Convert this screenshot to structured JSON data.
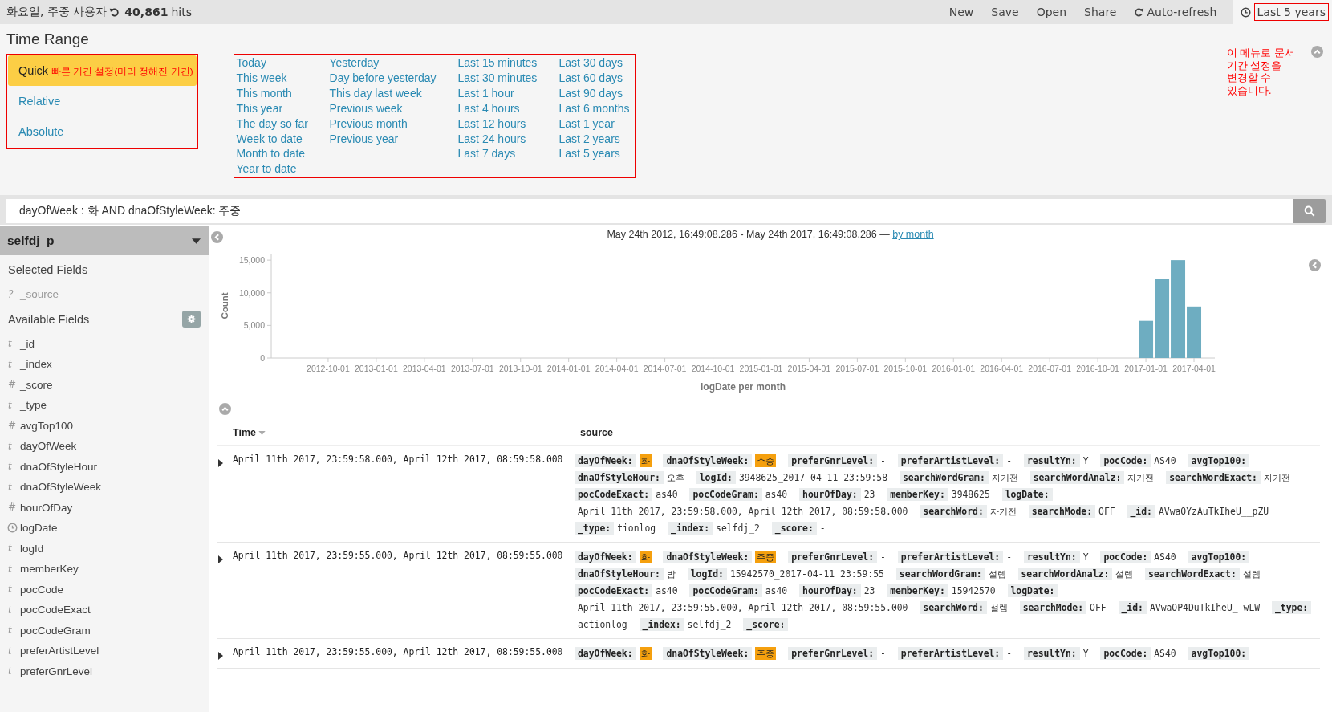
{
  "top_bar": {
    "title": "화요일, 주중 사용자",
    "hits_count": "40,861",
    "hits_label": "hits",
    "menu": [
      {
        "label": "New",
        "kind": "action"
      },
      {
        "label": "Save",
        "kind": "action"
      },
      {
        "label": "Open",
        "kind": "action"
      },
      {
        "label": "Share",
        "kind": "action"
      },
      {
        "label": "Auto-refresh",
        "kind": "refresh"
      }
    ],
    "time_picker": {
      "label": "Last 5 years"
    }
  },
  "time_range": {
    "title": "Time Range",
    "modes": [
      {
        "label": "Quick",
        "selected": true,
        "annotation": "빠른 기간 설정(미리 정해진 기간)"
      },
      {
        "label": "Relative",
        "selected": false
      },
      {
        "label": "Absolute",
        "selected": false
      }
    ],
    "quick_ranges": [
      [
        "Today",
        "This week",
        "This month",
        "This year",
        "The day so far",
        "Week to date",
        "Month to date",
        "Year to date"
      ],
      [
        "Yesterday",
        "Day before yesterday",
        "This day last week",
        "Previous week",
        "Previous month",
        "Previous year"
      ],
      [
        "Last 15 minutes",
        "Last 30 minutes",
        "Last 1 hour",
        "Last 4 hours",
        "Last 12 hours",
        "Last 24 hours",
        "Last 7 days"
      ],
      [
        "Last 30 days",
        "Last 60 days",
        "Last 90 days",
        "Last 6 months",
        "Last 1 year",
        "Last 2 years",
        "Last 5 years"
      ]
    ],
    "annotation": "이 메뉴로 문서 기간 설정을 변경할 수 있습니다."
  },
  "query": {
    "value": "dayOfWeek : 화 AND dnaOfStyleWeek: 주중"
  },
  "sidebar": {
    "index_pattern": "selfdj_p",
    "selected_fields_title": "Selected Fields",
    "selected_fields": [
      {
        "name": "_source",
        "kind": "unknown",
        "glyph": "?"
      }
    ],
    "available_fields_title": "Available Fields",
    "available_fields": [
      {
        "name": "_id",
        "kind": "string",
        "glyph": "t"
      },
      {
        "name": "_index",
        "kind": "string",
        "glyph": "t"
      },
      {
        "name": "_score",
        "kind": "number",
        "glyph": "#"
      },
      {
        "name": "_type",
        "kind": "string",
        "glyph": "t"
      },
      {
        "name": "avgTop100",
        "kind": "number",
        "glyph": "#"
      },
      {
        "name": "dayOfWeek",
        "kind": "string",
        "glyph": "t"
      },
      {
        "name": "dnaOfStyleHour",
        "kind": "string",
        "glyph": "t"
      },
      {
        "name": "dnaOfStyleWeek",
        "kind": "string",
        "glyph": "t"
      },
      {
        "name": "hourOfDay",
        "kind": "number",
        "glyph": "#"
      },
      {
        "name": "logDate",
        "kind": "date"
      },
      {
        "name": "logId",
        "kind": "string",
        "glyph": "t"
      },
      {
        "name": "memberKey",
        "kind": "string",
        "glyph": "t"
      },
      {
        "name": "pocCode",
        "kind": "string",
        "glyph": "t"
      },
      {
        "name": "pocCodeExact",
        "kind": "string",
        "glyph": "t"
      },
      {
        "name": "pocCodeGram",
        "kind": "string",
        "glyph": "t"
      },
      {
        "name": "preferArtistLevel",
        "kind": "string",
        "glyph": "t"
      },
      {
        "name": "preferGnrLevel",
        "kind": "string",
        "glyph": "t"
      }
    ]
  },
  "histogram": {
    "range_text": "May 24th 2012, 16:49:08.286 - May 24th 2017, 16:49:08.286 — ",
    "interval_link": "by month",
    "chart_data": {
      "type": "bar",
      "xlabel": "logDate per month",
      "ylabel": "Count",
      "ylim": [
        0,
        16000
      ],
      "yticks": [
        {
          "value": 0,
          "label": "0"
        },
        {
          "value": 5000,
          "label": "5,000"
        },
        {
          "value": 10000,
          "label": "10,000"
        },
        {
          "value": 15000,
          "label": "15,000"
        }
      ],
      "categories": [
        null,
        null,
        null,
        "2012-10-01",
        null,
        null,
        "2013-01-01",
        null,
        null,
        "2013-04-01",
        null,
        null,
        "2013-07-01",
        null,
        null,
        "2013-10-01",
        null,
        null,
        "2014-01-01",
        null,
        null,
        "2014-04-01",
        null,
        null,
        "2014-07-01",
        null,
        null,
        "2014-10-01",
        null,
        null,
        "2015-01-01",
        null,
        null,
        "2015-04-01",
        null,
        null,
        "2015-07-01",
        null,
        null,
        "2015-10-01",
        null,
        null,
        "2016-01-01",
        null,
        null,
        "2016-04-01",
        null,
        null,
        "2016-07-01",
        null,
        null,
        "2016-10-01",
        null,
        null,
        "2017-01-01",
        null,
        null,
        "2017-04-01"
      ],
      "series": [
        {
          "color": "#6eadc1",
          "values": [
            null,
            null,
            null,
            null,
            null,
            null,
            null,
            null,
            null,
            null,
            null,
            null,
            null,
            null,
            null,
            null,
            null,
            null,
            null,
            null,
            null,
            null,
            null,
            null,
            null,
            null,
            null,
            null,
            null,
            null,
            null,
            null,
            null,
            null,
            null,
            null,
            null,
            null,
            null,
            null,
            null,
            null,
            null,
            null,
            null,
            null,
            null,
            null,
            null,
            null,
            null,
            null,
            null,
            null,
            5700,
            12100,
            15000,
            7900
          ]
        }
      ]
    }
  },
  "documents": {
    "columns": [
      "Time",
      "_source"
    ],
    "rows": [
      {
        "time": "April 11th 2017, 23:59:58.000, April 12th 2017, 08:59:58.000",
        "source": [
          {
            "key": "dayOfWeek:",
            "value": "화",
            "highlighted": true
          },
          {
            "key": "dnaOfStyleWeek:",
            "value": "주중",
            "highlighted": true
          },
          {
            "key": "preferGnrLevel:",
            "value": "-",
            "highlighted": false
          },
          {
            "key": "preferArtistLevel:",
            "value": "-",
            "highlighted": false
          },
          {
            "key": "resultYn:",
            "value": "Y",
            "highlighted": false
          },
          {
            "key": "pocCode:",
            "value": "AS40",
            "highlighted": false
          },
          {
            "key": "avgTop100:"
          },
          {
            "key": "dnaOfStyleHour:",
            "value": "오후",
            "highlighted": false
          },
          {
            "key": "logId:",
            "value": "3948625_2017-04-11 23:59:58",
            "highlighted": false
          },
          {
            "key": "searchWordGram:",
            "value": "자기전",
            "highlighted": false
          },
          {
            "key": "searchWordAnalz:",
            "value": "자기전",
            "highlighted": false
          },
          {
            "key": "searchWordExact:",
            "value": "자기전",
            "highlighted": false
          },
          {
            "key": "pocCodeExact:",
            "value": "as40",
            "highlighted": false
          },
          {
            "key": "pocCodeGram:",
            "value": "as40",
            "highlighted": false
          },
          {
            "key": "hourOfDay:",
            "value": "23",
            "highlighted": false
          },
          {
            "key": "memberKey:",
            "value": "3948625",
            "highlighted": false
          },
          {
            "key": "logDate:",
            "value": "April 11th 2017, 23:59:58.000, April 12th 2017, 08:59:58.000",
            "highlighted": false
          },
          {
            "key": "searchWord:",
            "value": "자기전",
            "highlighted": false
          },
          {
            "key": "searchMode:",
            "value": "OFF",
            "highlighted": false
          },
          {
            "key": "_id:",
            "value": "AVwaOYzAuTkIheU__pZU",
            "highlighted": false
          },
          {
            "key": "_type:",
            "value": "tionlog",
            "highlighted": false
          },
          {
            "key": "_index:",
            "value": "selfdj_2",
            "highlighted": false
          },
          {
            "key": "_score:",
            "value": "-",
            "highlighted": false
          }
        ]
      },
      {
        "time": "April 11th 2017, 23:59:55.000, April 12th 2017, 08:59:55.000",
        "source": [
          {
            "key": "dayOfWeek:",
            "value": "화",
            "highlighted": true
          },
          {
            "key": "dnaOfStyleWeek:",
            "value": "주중",
            "highlighted": true
          },
          {
            "key": "preferGnrLevel:",
            "value": "-",
            "highlighted": false
          },
          {
            "key": "preferArtistLevel:",
            "value": "-",
            "highlighted": false
          },
          {
            "key": "resultYn:",
            "value": "Y",
            "highlighted": false
          },
          {
            "key": "pocCode:",
            "value": "AS40",
            "highlighted": false
          },
          {
            "key": "avgTop100:"
          },
          {
            "key": "dnaOfStyleHour:",
            "value": "밤",
            "highlighted": false
          },
          {
            "key": "logId:",
            "value": "15942570_2017-04-11 23:59:55",
            "highlighted": false
          },
          {
            "key": "searchWordGram:",
            "value": "설렘",
            "highlighted": false
          },
          {
            "key": "searchWordAnalz:",
            "value": "설렘",
            "highlighted": false
          },
          {
            "key": "searchWordExact:",
            "value": "설렘",
            "highlighted": false
          },
          {
            "key": "pocCodeExact:",
            "value": "as40",
            "highlighted": false
          },
          {
            "key": "pocCodeGram:",
            "value": "as40",
            "highlighted": false
          },
          {
            "key": "hourOfDay:",
            "value": "23",
            "highlighted": false
          },
          {
            "key": "memberKey:",
            "value": "15942570",
            "highlighted": false
          },
          {
            "key": "logDate:",
            "value": "April 11th 2017, 23:59:55.000, April 12th 2017, 08:59:55.000",
            "highlighted": false
          },
          {
            "key": "searchWord:",
            "value": "설렘",
            "highlighted": false
          },
          {
            "key": "searchMode:",
            "value": "OFF",
            "highlighted": false
          },
          {
            "key": "_id:",
            "value": "AVwaOP4DuTkIheU_-wLW",
            "highlighted": false
          },
          {
            "key": "_type:",
            "value": "actionlog",
            "highlighted": false
          },
          {
            "key": "_index:",
            "value": "selfdj_2",
            "highlighted": false
          },
          {
            "key": "_score:",
            "value": "-",
            "highlighted": false
          }
        ]
      },
      {
        "time": "April 11th 2017, 23:59:55.000, April 12th 2017, 08:59:55.000",
        "source": [
          {
            "key": "dayOfWeek:",
            "value": "화",
            "highlighted": true
          },
          {
            "key": "dnaOfStyleWeek:",
            "value": "주중",
            "highlighted": true
          },
          {
            "key": "preferGnrLevel:",
            "value": "-",
            "highlighted": false
          },
          {
            "key": "preferArtistLevel:",
            "value": "-",
            "highlighted": false
          },
          {
            "key": "resultYn:",
            "value": "Y",
            "highlighted": false
          },
          {
            "key": "pocCode:",
            "value": "AS40",
            "highlighted": false
          },
          {
            "key": "avgTop100:"
          }
        ]
      }
    ]
  }
}
